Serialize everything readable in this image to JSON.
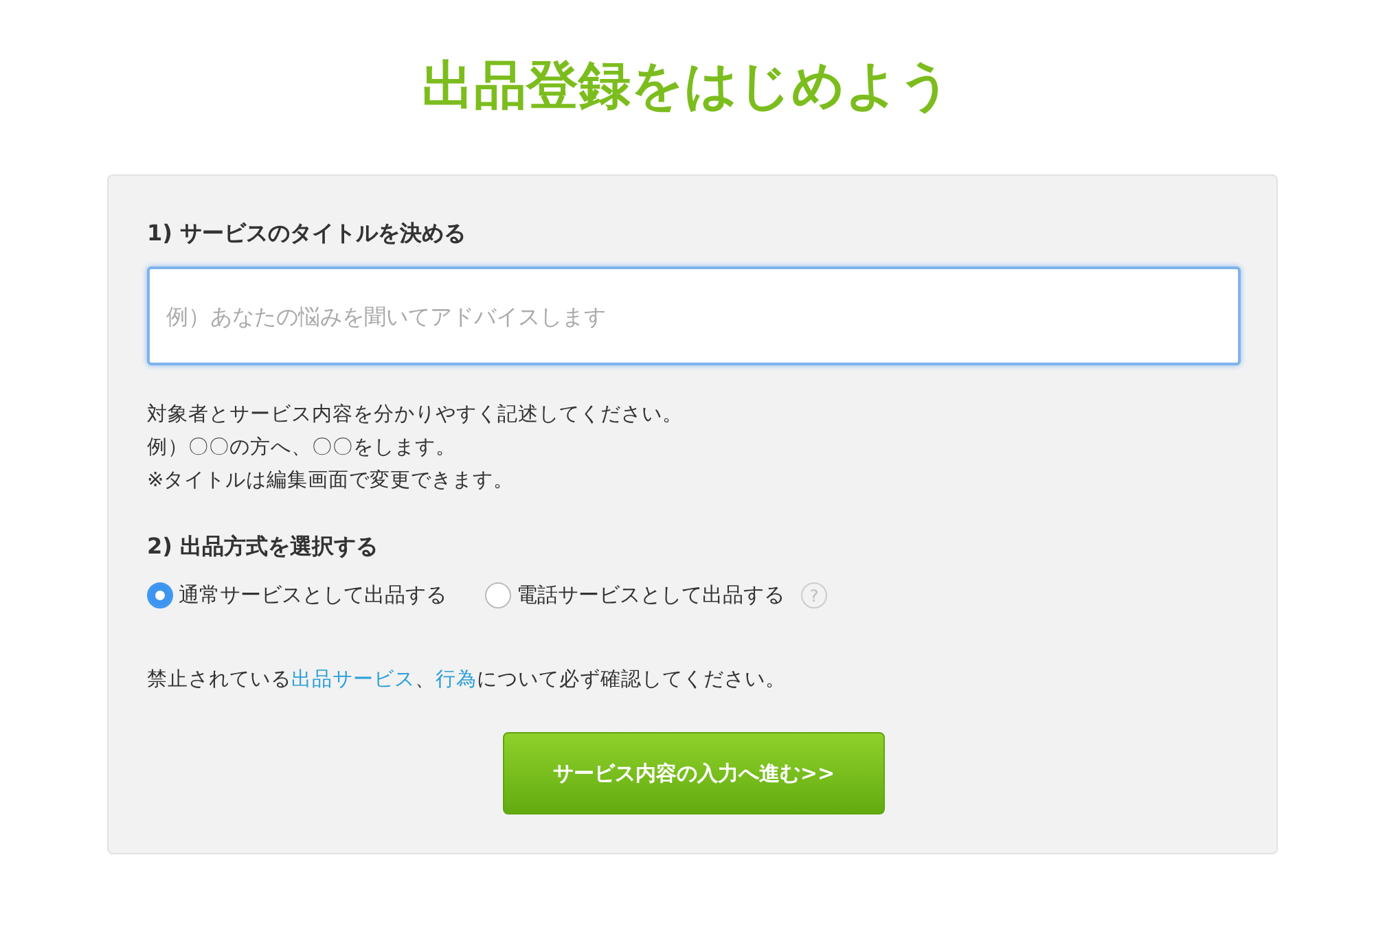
{
  "title": "出品登録をはじめよう",
  "section1": {
    "heading": "1) サービスのタイトルを決める",
    "title_field": {
      "placeholder": "例）あなたの悩みを聞いてアドバイスします"
    },
    "hints": [
      "対象者とサービス内容を分かりやすく記述してください。",
      "例）〇〇の方へ、〇〇をします。",
      "※タイトルは編集画面で変更できます。"
    ]
  },
  "section2": {
    "heading": "2) 出品方式を選択する",
    "options": [
      {
        "label": "通常サービスとして出品する",
        "selected": true
      },
      {
        "label": "電話サービスとして出品する",
        "selected": false,
        "help": "?"
      }
    ]
  },
  "notice": [
    {
      "kind": "text",
      "text": "禁止されている"
    },
    {
      "kind": "link",
      "text": "出品サービス"
    },
    {
      "kind": "text",
      "text": "、"
    },
    {
      "kind": "link",
      "text": "行為"
    },
    {
      "kind": "text",
      "text": "について必ず確認してください。"
    }
  ],
  "submit_button": "サービス内容の入力へ進む>>"
}
